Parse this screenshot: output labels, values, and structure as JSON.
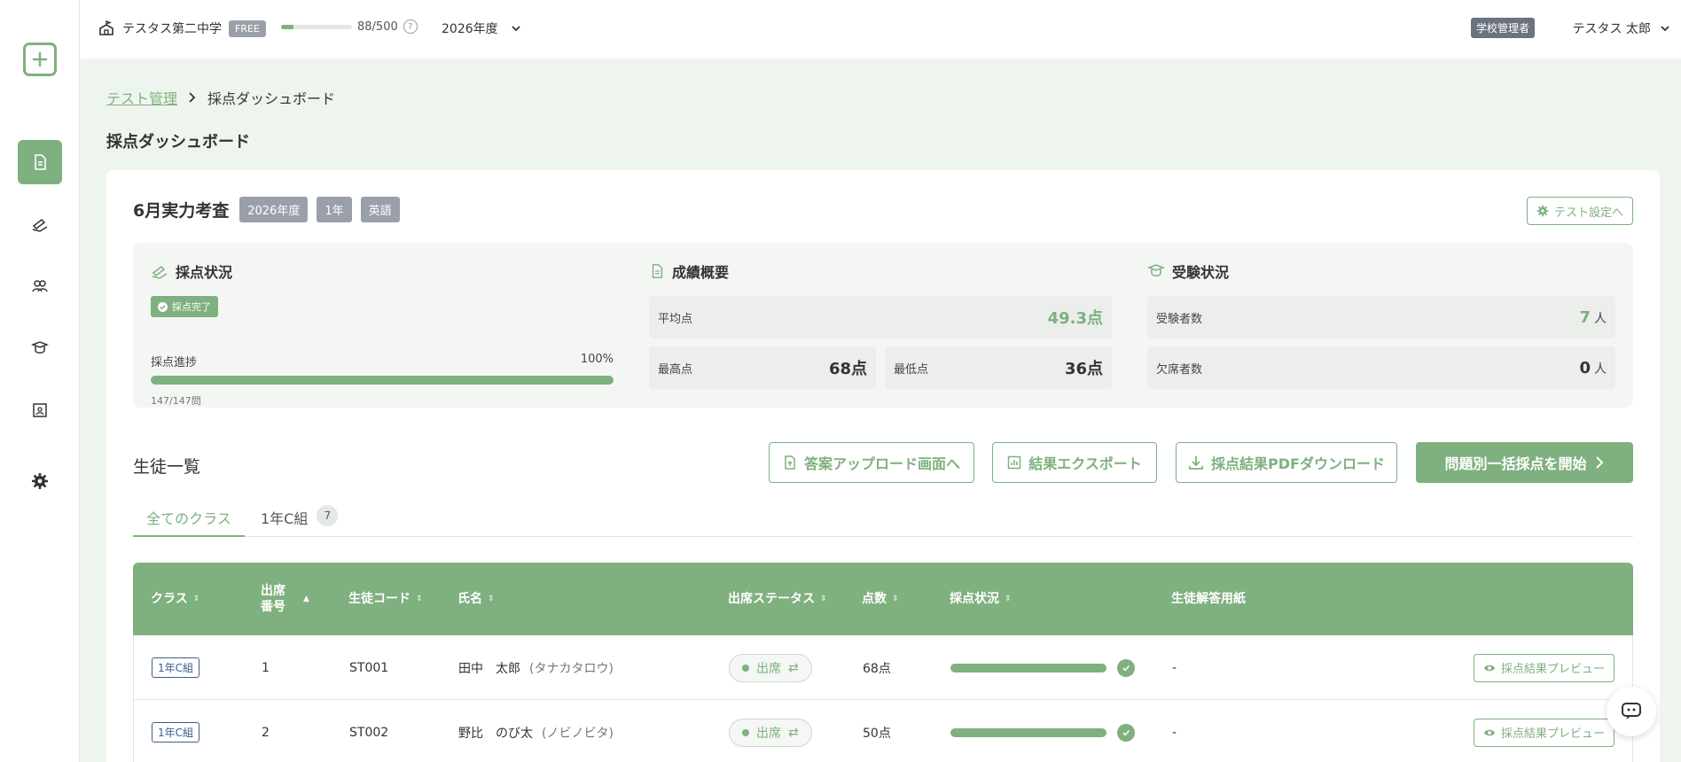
{
  "topbar": {
    "school_name": "テスタス第二中学",
    "plan_badge": "FREE",
    "quota_text": "88/500",
    "quota_fraction": 0.176,
    "help_symbol": "?",
    "year_select": "2026年度",
    "role_badge": "学校管理者",
    "user_name": "テスタス 太郎"
  },
  "breadcrumb": {
    "parent": "テスト管理",
    "current": "採点ダッシュボード"
  },
  "page_title": "採点ダッシュボード",
  "test": {
    "name": "6月実力考査",
    "tags": [
      "2026年度",
      "1年",
      "英語"
    ],
    "settings_button": "テスト設定へ"
  },
  "grading": {
    "title": "採点状況",
    "badge": "採点完了",
    "progress_label": "採点進捗",
    "progress_percent": "100%",
    "progress_fraction": 1.0,
    "progress_count": "147/147問"
  },
  "scores": {
    "title": "成績概要",
    "avg_label": "平均点",
    "avg_value": "49.3点",
    "max_label": "最高点",
    "max_value": "68点",
    "min_label": "最低点",
    "min_value": "36点"
  },
  "exam": {
    "title": "受験状況",
    "taken_label": "受験者数",
    "taken_value": "7",
    "absent_label": "欠席者数",
    "absent_value": "0",
    "unit": "人"
  },
  "student_list": {
    "title": "生徒一覧",
    "btn_upload": "答案アップロード画面へ",
    "btn_export": "結果エクスポート",
    "btn_pdf": "採点結果PDFダウンロード",
    "btn_start": "問題別一括採点を開始"
  },
  "tabs": [
    {
      "label": "全てのクラス"
    },
    {
      "label": "1年C組",
      "count": "7"
    }
  ],
  "table": {
    "headers": {
      "cls": "クラス",
      "num_line1": "出席",
      "num_line2": "番号",
      "code": "生徒コード",
      "name": "氏名",
      "attendance": "出席ステータス",
      "score": "点数",
      "grading": "採点状況",
      "sheet": "生徒解答用紙"
    },
    "rows": [
      {
        "cls": "1年C組",
        "num": "1",
        "code": "ST001",
        "name": "田中　太郎",
        "kana": "(タナカタロウ)",
        "attendance": "出席",
        "score": "68点",
        "grading_fraction": 1.0,
        "sheet": "-",
        "preview": "採点結果プレビュー"
      },
      {
        "cls": "1年C組",
        "num": "2",
        "code": "ST002",
        "name": "野比　のび太",
        "kana": "(ノビノビタ)",
        "attendance": "出席",
        "score": "50点",
        "grading_fraction": 1.0,
        "sheet": "-",
        "preview": "採点結果プレビュー"
      }
    ]
  },
  "colors": {
    "accent": "#7fb07f",
    "tag_gray": "#9aa0aa",
    "class_badge": "#3b5e8a"
  }
}
